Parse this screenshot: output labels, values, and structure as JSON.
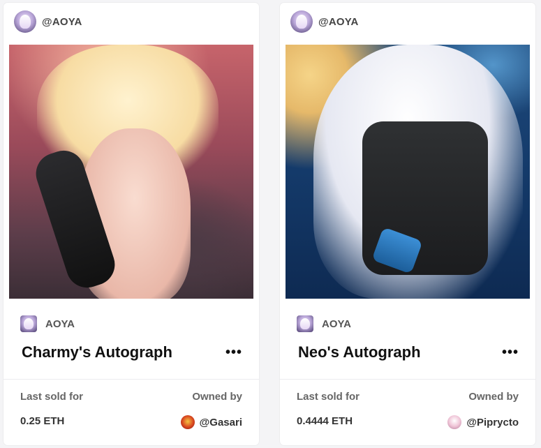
{
  "cards": [
    {
      "creator_handle": "@AOYA",
      "artist_name": "AOYA",
      "title": "Charmy's Autograph",
      "more_icon": "•••",
      "last_sold_label": "Last sold for",
      "last_sold_value": "0.25 ETH",
      "owned_by_label": "Owned by",
      "owner_handle": "@Gasari"
    },
    {
      "creator_handle": "@AOYA",
      "artist_name": "AOYA",
      "title": "Neo's Autograph",
      "more_icon": "•••",
      "last_sold_label": "Last sold for",
      "last_sold_value": "0.4444 ETH",
      "owned_by_label": "Owned by",
      "owner_handle": "@Piprycto"
    }
  ],
  "colors": {
    "page_background": "#f4f4f6",
    "card_background": "#ffffff",
    "title_text": "#111111",
    "muted_text": "#666666"
  }
}
